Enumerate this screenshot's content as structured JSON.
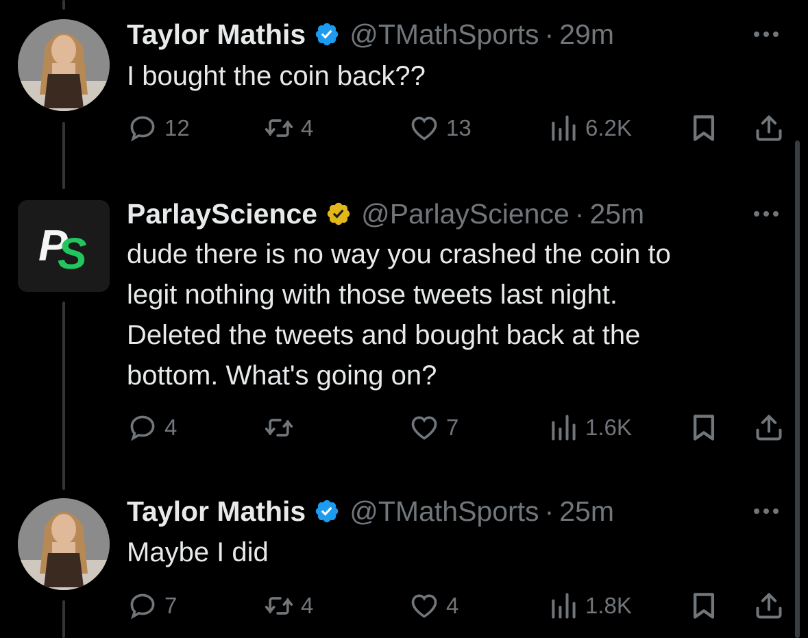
{
  "tweets": [
    {
      "name": "Taylor Mathis",
      "handle": "@TMathSports",
      "time": "29m",
      "text": "I bought the coin back??",
      "replies": "12",
      "retweets": "4",
      "likes": "13",
      "views": "6.2K",
      "verified_color": "#1d9bf0"
    },
    {
      "name": "ParlayScience",
      "handle": "@ParlayScience",
      "time": "25m",
      "text": "dude there is no way you crashed the coin to\nlegit nothing with those tweets last night.\nDeleted the tweets and bought back at the\nbottom. What's going on?",
      "replies": "4",
      "retweets": "",
      "likes": "7",
      "views": "1.6K",
      "verified_color": "#e2b719",
      "logo_text_p": "P",
      "logo_text_s": "S"
    },
    {
      "name": "Taylor Mathis",
      "handle": "@TMathSports",
      "time": "25m",
      "text": "Maybe I did",
      "replies": "7",
      "retweets": "4",
      "likes": "4",
      "views": "1.8K",
      "verified_color": "#1d9bf0"
    }
  ],
  "separator": "·",
  "icons": {
    "reply": "reply-icon",
    "retweet": "retweet-icon",
    "like": "heart-icon",
    "views": "views-icon",
    "bookmark": "bookmark-icon",
    "share": "share-icon",
    "more": "more-icon",
    "verified": "verified-badge-icon"
  },
  "colors": {
    "background": "#000000",
    "text": "#e7e9ea",
    "muted": "#71767b",
    "logo_green": "#22c55e"
  }
}
